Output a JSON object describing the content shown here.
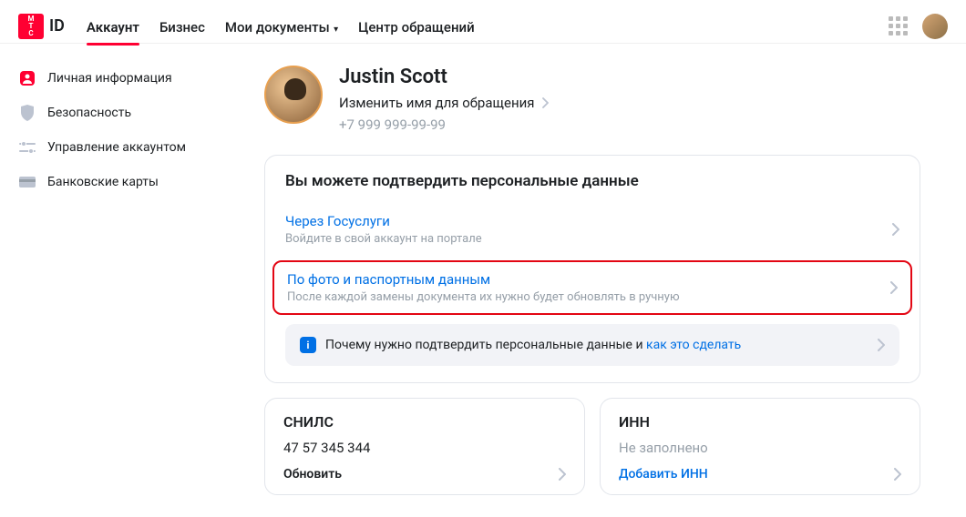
{
  "header": {
    "logo_abbr": "МТС",
    "logo_text": "ID",
    "nav": [
      {
        "label": "Аккаунт",
        "active": true
      },
      {
        "label": "Бизнес",
        "active": false
      },
      {
        "label": "Мои документы",
        "active": false,
        "dropdown": true
      },
      {
        "label": "Центр обращений",
        "active": false
      }
    ]
  },
  "sidebar": {
    "items": [
      {
        "label": "Личная информация",
        "icon": "person"
      },
      {
        "label": "Безопасность",
        "icon": "shield"
      },
      {
        "label": "Управление аккаунтом",
        "icon": "sliders"
      },
      {
        "label": "Банковские карты",
        "icon": "card"
      }
    ]
  },
  "profile": {
    "name": "Justin Scott",
    "edit_label": "Изменить имя для обращения",
    "phone": "+7 999 999-99-99"
  },
  "verify": {
    "title": "Вы можете подтвердить персональные данные",
    "options": [
      {
        "title": "Через Госуслуги",
        "sub": "Войдите в свой аккаунт на портале",
        "highlighted": false
      },
      {
        "title": "По фото и паспортным данным",
        "sub": "После каждой замены документа их нужно будет обновлять в ручную",
        "highlighted": true
      }
    ],
    "info_prefix": "Почему нужно подтвердить персональные данные и ",
    "info_link": "как это сделать"
  },
  "cards": {
    "snils": {
      "title": "СНИЛС",
      "value": "47 57 345 344",
      "action": "Обновить",
      "empty": false
    },
    "inn": {
      "title": "ИНН",
      "value": "Не заполнено",
      "action": "Добавить ИНН",
      "empty": true
    }
  }
}
